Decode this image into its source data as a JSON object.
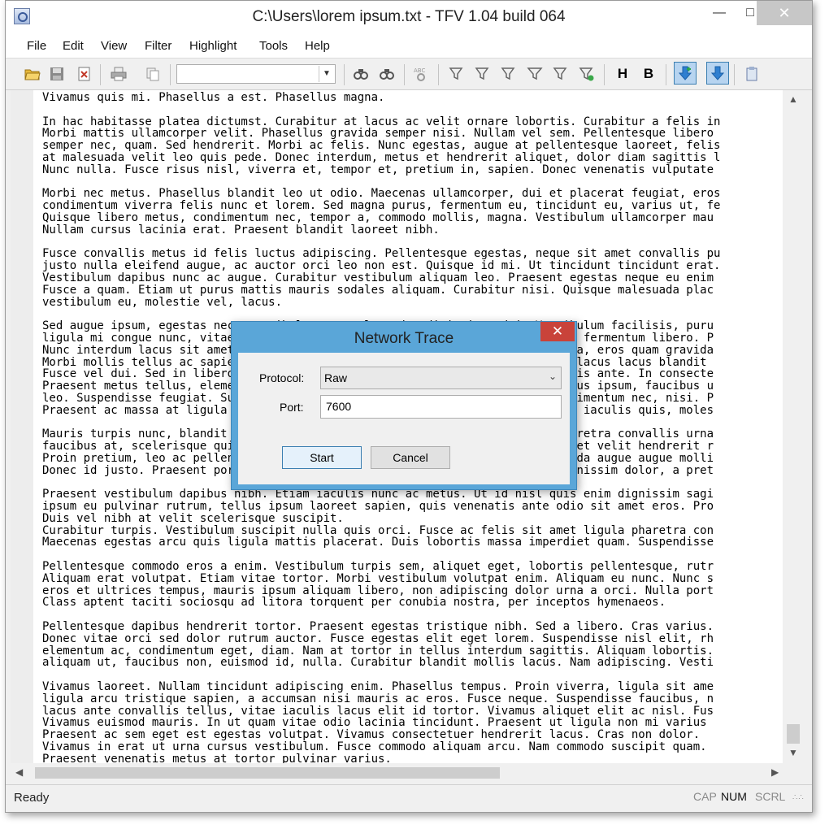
{
  "window": {
    "title": "C:\\Users\\lorem ipsum.txt - TFV 1.04 build 064",
    "min_glyph": "—",
    "max_glyph": "□",
    "close_glyph": "✕"
  },
  "menu": [
    "File",
    "Edit",
    "View",
    "Filter",
    "Highlight",
    "Tools",
    "Help"
  ],
  "toolbar": {
    "search_combo_value": "",
    "highlight_h_label": "H",
    "highlight_b_label": "B"
  },
  "content_lines": [
    "Vivamus quis mi. Phasellus a est. Phasellus magna.",
    "",
    "In hac habitasse platea dictumst. Curabitur at lacus ac velit ornare lobortis. Curabitur a felis in",
    "Morbi mattis ullamcorper velit. Phasellus gravida semper nisi. Nullam vel sem. Pellentesque libero",
    "semper nec, quam. Sed hendrerit. Morbi ac felis. Nunc egestas, augue at pellentesque laoreet, felis",
    "at malesuada velit leo quis pede. Donec interdum, metus et hendrerit aliquet, dolor diam sagittis l",
    "Nunc nulla. Fusce risus nisl, viverra et, tempor et, pretium in, sapien. Donec venenatis vulputate",
    "",
    "Morbi nec metus. Phasellus blandit leo ut odio. Maecenas ullamcorper, dui et placerat feugiat, eros",
    "condimentum viverra felis nunc et lorem. Sed magna purus, fermentum eu, tincidunt eu, varius ut, fe",
    "Quisque libero metus, condimentum nec, tempor a, commodo mollis, magna. Vestibulum ullamcorper mau",
    "Nullam cursus lacinia erat. Praesent blandit laoreet nibh.",
    "",
    "Fusce convallis metus id felis luctus adipiscing. Pellentesque egestas, neque sit amet convallis pu",
    "justo nulla eleifend augue, ac auctor orci leo non est. Quisque id mi. Ut tincidunt tincidunt erat.",
    "Vestibulum dapibus nunc ac augue. Curabitur vestibulum aliquam leo. Praesent egestas neque eu enim",
    "Fusce a quam. Etiam ut purus mattis mauris sodales aliquam. Curabitur nisi. Quisque malesuada plac",
    "vestibulum eu, molestie vel, lacus.",
    "",
    "Sed augue ipsum, egestas nec, vestibulum et, malesuada adipiscing, dui. Vestibulum facilisis, puru",
    "ligula mi congue nunc, vitae euismod ligula urna in dolor. Mauris sollicitudin fermentum libero. P",
    "Nunc interdum lacus sit amet orci. Vestibulum rutrum, mi nec elementum vehicula, eros quam gravida",
    "Morbi mollis tellus ac sapien. Phasellus volutpat, metus eget egestas mollis, lacus lacus blandit",
    "Fusce vel dui. Sed in libero ut nibh placerat accumsan. Proin faucibus arcu quis ante. In consecte",
    "Praesent metus tellus, elementum eu, semper a, adipiscing nec, purus. Cras risus ipsum, faucibus u",
    "leo. Suspendisse feugiat. Suspendisse enim turpis, dictum sed, iaculis a, condimentum nec, nisi. P",
    "Praesent ac massa at ligula laoreet iaculis. Nulla neque dolor, sagittis eget, iaculis quis, moles",
    "",
    "Mauris turpis nunc, blandit et, volutpat molestie, porta ut, ligula. Fusce pharetra convallis urna",
    "faucibus at, scelerisque quis, convallis in, nisi. Suspendisse non nisl sit amet velit hendrerit r",
    "Proin pretium, leo ac pellentesque mollis, felis nunc ultrices eros, sed gravida augue augue molli",
    "Donec id justo. Praesent porttitor, nulla vitae posuere iaculis, arcu nisl dignissim dolor, a pret",
    "",
    "Praesent vestibulum dapibus nibh. Etiam iaculis nunc ac metus. Ut id nisl quis enim dignissim sagi",
    "ipsum eu pulvinar rutrum, tellus ipsum laoreet sapien, quis venenatis ante odio sit amet eros. Pro",
    "Duis vel nibh at velit scelerisque suscipit.",
    "Curabitur turpis. Vestibulum suscipit nulla quis orci. Fusce ac felis sit amet ligula pharetra con",
    "Maecenas egestas arcu quis ligula mattis placerat. Duis lobortis massa imperdiet quam. Suspendisse",
    "",
    "Pellentesque commodo eros a enim. Vestibulum turpis sem, aliquet eget, lobortis pellentesque, rutr",
    "Aliquam erat volutpat. Etiam vitae tortor. Morbi vestibulum volutpat enim. Aliquam eu nunc. Nunc s",
    "eros et ultrices tempus, mauris ipsum aliquam libero, non adipiscing dolor urna a orci. Nulla port",
    "Class aptent taciti sociosqu ad litora torquent per conubia nostra, per inceptos hymenaeos.",
    "",
    "Pellentesque dapibus hendrerit tortor. Praesent egestas tristique nibh. Sed a libero. Cras varius.",
    "Donec vitae orci sed dolor rutrum auctor. Fusce egestas elit eget lorem. Suspendisse nisl elit, rh",
    "elementum ac, condimentum eget, diam. Nam at tortor in tellus interdum sagittis. Aliquam lobortis.",
    "aliquam ut, faucibus non, euismod id, nulla. Curabitur blandit mollis lacus. Nam adipiscing. Vesti",
    "",
    "Vivamus laoreet. Nullam tincidunt adipiscing enim. Phasellus tempus. Proin viverra, ligula sit ame",
    "ligula arcu tristique sapien, a accumsan nisi mauris ac eros. Fusce neque. Suspendisse faucibus, n",
    "lacus ante convallis tellus, vitae iaculis lacus elit id tortor. Vivamus aliquet elit ac nisl. Fus",
    "Vivamus euismod mauris. In ut quam vitae odio lacinia tincidunt. Praesent ut ligula non mi varius",
    "Praesent ac sem eget est egestas volutpat. Vivamus consectetuer hendrerit lacus. Cras non dolor.",
    "Vivamus in erat ut urna cursus vestibulum. Fusce commodo aliquam arcu. Nam commodo suscipit quam.",
    "Praesent venenatis metus at tortor pulvinar varius."
  ],
  "status": {
    "text": "Ready",
    "cap": "CAP",
    "num": "NUM",
    "scrl": "SCRL"
  },
  "dialog": {
    "title": "Network Trace",
    "close_glyph": "✕",
    "protocol_label": "Protocol:",
    "protocol_value": "Raw",
    "port_label": "Port:",
    "port_value": "7600",
    "start_label": "Start",
    "cancel_label": "Cancel"
  },
  "colors": {
    "dialog_frame": "#5aa6d8",
    "dialog_close": "#c9433a",
    "toggle_active": "#b7d4f0"
  }
}
